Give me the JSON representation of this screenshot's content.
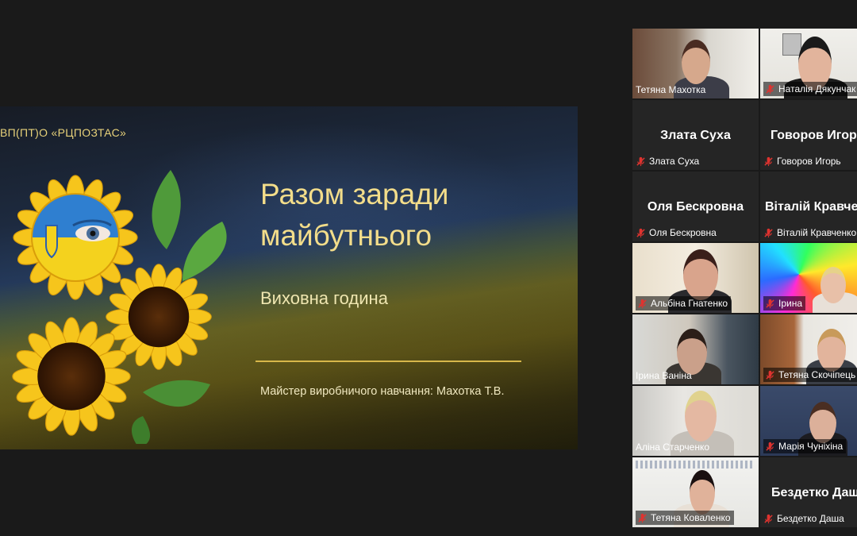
{
  "slide": {
    "org": "ВП(ПТ)О «РЦПОЗТАС»",
    "title_line1": "Разом заради",
    "title_line2": "майбутнього",
    "subtitle": "Виховна година",
    "author": "Майстер виробничого навчання: Махотка Т.В."
  },
  "participants": [
    {
      "name": "Тетяна Махотка",
      "muted": false,
      "active": true,
      "video": true
    },
    {
      "name": "Наталія Дякунчак",
      "muted": true,
      "video": true
    },
    {
      "name": "Злата Суха",
      "display": "Злата Суха",
      "muted": true,
      "video": false
    },
    {
      "name": "Говоров Игорь",
      "display": "Говоров Игорь",
      "muted": true,
      "video": false
    },
    {
      "name": "Оля Бескровна",
      "display": "Оля Бескровна",
      "muted": true,
      "video": false
    },
    {
      "name": "Віталій Кравченко",
      "display": "Віталій Кравченко",
      "muted": true,
      "video": false
    },
    {
      "name": "Альбіна Гнатенко",
      "muted": true,
      "video": true
    },
    {
      "name": "Ірина",
      "muted": true,
      "video": true
    },
    {
      "name": "Ірина Ваніна",
      "muted": false,
      "video": true
    },
    {
      "name": "Тетяна Скочіпець",
      "muted": true,
      "video": true
    },
    {
      "name": "Аліна Старченко",
      "muted": false,
      "video": true
    },
    {
      "name": "Марія Чуніхіна",
      "muted": true,
      "video": true
    },
    {
      "name": "Тетяна Коваленко",
      "muted": true,
      "video": true
    },
    {
      "name": "Бездетко Даша",
      "display": "Бездетко Даша",
      "muted": true,
      "video": false
    }
  ],
  "colors": {
    "active_border": "#2fce6f",
    "muted_icon": "#e0332f",
    "title_gold": "#f3dd8a"
  }
}
